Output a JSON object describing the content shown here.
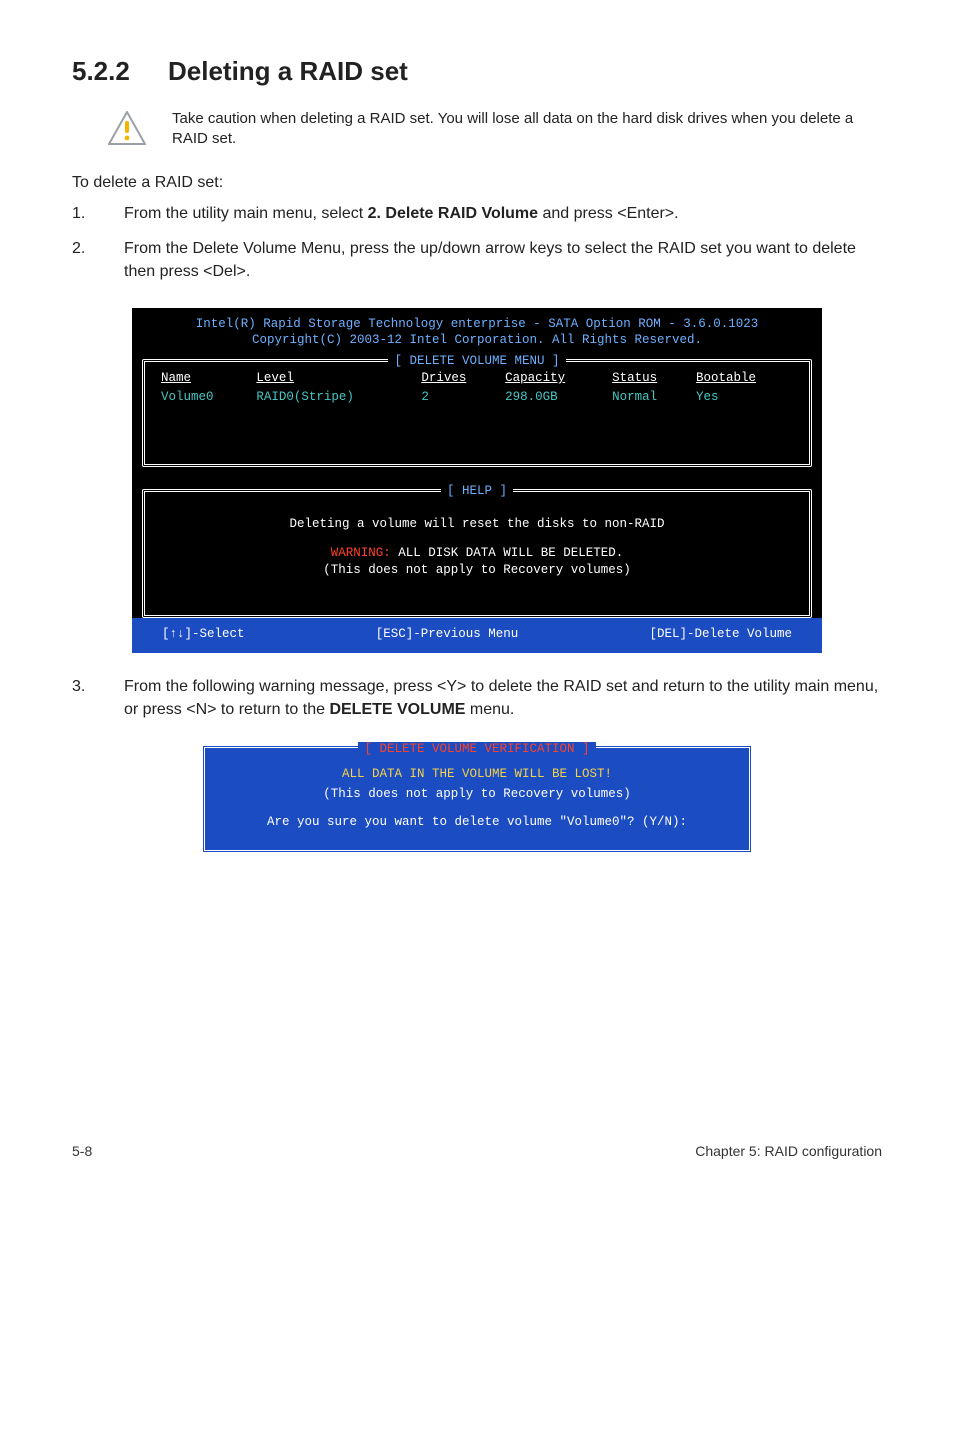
{
  "header": {
    "section_number": "5.2.2",
    "title": "Deleting a RAID set"
  },
  "note": {
    "text": "Take caution when deleting a RAID set. You will lose all data on the hard disk drives when you delete a RAID set."
  },
  "intro": "To delete a RAID set:",
  "steps": {
    "s1_pre": "From the utility main menu, select ",
    "s1_bold": "2. Delete RAID Volume",
    "s1_post": " and press <Enter>.",
    "s2": "From the Delete Volume Menu, press the up/down arrow keys to select the RAID set you want to delete then press <Del>.",
    "s3_pre": "From the following warning message, press <Y> to delete the RAID set and return to the utility main menu, or press <N> to return to the ",
    "s3_bold": "DELETE VOLUME",
    "s3_post": " menu."
  },
  "bios": {
    "title_line1": "Intel(R) Rapid Storage Technology enterprise - SATA Option ROM - 3.6.0.1023",
    "title_line2": "Copyright(C) 2003-12 Intel Corporation.  All Rights Reserved.",
    "frame1_title": "[ DELETE VOLUME MENU ]",
    "cols": {
      "c1": "Name",
      "c2": "Level",
      "c3": "Drives",
      "c4": "Capacity",
      "c5": "Status",
      "c6": "Bootable"
    },
    "row": {
      "c1": "Volume0",
      "c2": "RAID0(Stripe)",
      "c3": "2",
      "c4": "298.0GB",
      "c5": "Normal",
      "c6": "Yes"
    },
    "frame2_title": "[ HELP ]",
    "help1": "Deleting a volume will reset the disks to non-RAID",
    "help_warn_prefix": "WARNING: ",
    "help_warn_rest": "ALL DISK DATA WILL BE DELETED.",
    "help3": "(This does not apply to Recovery volumes)",
    "footer_left": "[↑↓]-Select",
    "footer_mid": "[ESC]-Previous Menu",
    "footer_right": "[DEL]-Delete Volume"
  },
  "dialog": {
    "title": "[ DELETE VOLUME VERIFICATION ]",
    "l1": "ALL DATA IN THE VOLUME WILL BE LOST!",
    "l2": "(This does not apply to Recovery volumes)",
    "l3": "Are you sure you want to delete volume \"Volume0\"? (Y/N):"
  },
  "footer": {
    "left": "5-8",
    "right": "Chapter 5: RAID configuration"
  }
}
